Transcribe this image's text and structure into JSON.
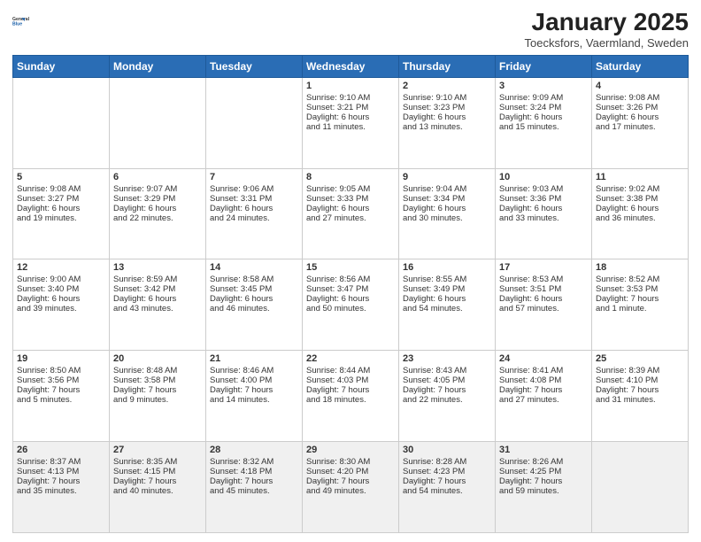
{
  "header": {
    "logo_line1": "General",
    "logo_line2": "Blue",
    "month_title": "January 2025",
    "location": "Toecksfors, Vaermland, Sweden"
  },
  "days_of_week": [
    "Sunday",
    "Monday",
    "Tuesday",
    "Wednesday",
    "Thursday",
    "Friday",
    "Saturday"
  ],
  "weeks": [
    [
      {
        "day": "",
        "info": ""
      },
      {
        "day": "",
        "info": ""
      },
      {
        "day": "",
        "info": ""
      },
      {
        "day": "1",
        "info": "Sunrise: 9:10 AM\nSunset: 3:21 PM\nDaylight: 6 hours\nand 11 minutes."
      },
      {
        "day": "2",
        "info": "Sunrise: 9:10 AM\nSunset: 3:23 PM\nDaylight: 6 hours\nand 13 minutes."
      },
      {
        "day": "3",
        "info": "Sunrise: 9:09 AM\nSunset: 3:24 PM\nDaylight: 6 hours\nand 15 minutes."
      },
      {
        "day": "4",
        "info": "Sunrise: 9:08 AM\nSunset: 3:26 PM\nDaylight: 6 hours\nand 17 minutes."
      }
    ],
    [
      {
        "day": "5",
        "info": "Sunrise: 9:08 AM\nSunset: 3:27 PM\nDaylight: 6 hours\nand 19 minutes."
      },
      {
        "day": "6",
        "info": "Sunrise: 9:07 AM\nSunset: 3:29 PM\nDaylight: 6 hours\nand 22 minutes."
      },
      {
        "day": "7",
        "info": "Sunrise: 9:06 AM\nSunset: 3:31 PM\nDaylight: 6 hours\nand 24 minutes."
      },
      {
        "day": "8",
        "info": "Sunrise: 9:05 AM\nSunset: 3:33 PM\nDaylight: 6 hours\nand 27 minutes."
      },
      {
        "day": "9",
        "info": "Sunrise: 9:04 AM\nSunset: 3:34 PM\nDaylight: 6 hours\nand 30 minutes."
      },
      {
        "day": "10",
        "info": "Sunrise: 9:03 AM\nSunset: 3:36 PM\nDaylight: 6 hours\nand 33 minutes."
      },
      {
        "day": "11",
        "info": "Sunrise: 9:02 AM\nSunset: 3:38 PM\nDaylight: 6 hours\nand 36 minutes."
      }
    ],
    [
      {
        "day": "12",
        "info": "Sunrise: 9:00 AM\nSunset: 3:40 PM\nDaylight: 6 hours\nand 39 minutes."
      },
      {
        "day": "13",
        "info": "Sunrise: 8:59 AM\nSunset: 3:42 PM\nDaylight: 6 hours\nand 43 minutes."
      },
      {
        "day": "14",
        "info": "Sunrise: 8:58 AM\nSunset: 3:45 PM\nDaylight: 6 hours\nand 46 minutes."
      },
      {
        "day": "15",
        "info": "Sunrise: 8:56 AM\nSunset: 3:47 PM\nDaylight: 6 hours\nand 50 minutes."
      },
      {
        "day": "16",
        "info": "Sunrise: 8:55 AM\nSunset: 3:49 PM\nDaylight: 6 hours\nand 54 minutes."
      },
      {
        "day": "17",
        "info": "Sunrise: 8:53 AM\nSunset: 3:51 PM\nDaylight: 6 hours\nand 57 minutes."
      },
      {
        "day": "18",
        "info": "Sunrise: 8:52 AM\nSunset: 3:53 PM\nDaylight: 7 hours\nand 1 minute."
      }
    ],
    [
      {
        "day": "19",
        "info": "Sunrise: 8:50 AM\nSunset: 3:56 PM\nDaylight: 7 hours\nand 5 minutes."
      },
      {
        "day": "20",
        "info": "Sunrise: 8:48 AM\nSunset: 3:58 PM\nDaylight: 7 hours\nand 9 minutes."
      },
      {
        "day": "21",
        "info": "Sunrise: 8:46 AM\nSunset: 4:00 PM\nDaylight: 7 hours\nand 14 minutes."
      },
      {
        "day": "22",
        "info": "Sunrise: 8:44 AM\nSunset: 4:03 PM\nDaylight: 7 hours\nand 18 minutes."
      },
      {
        "day": "23",
        "info": "Sunrise: 8:43 AM\nSunset: 4:05 PM\nDaylight: 7 hours\nand 22 minutes."
      },
      {
        "day": "24",
        "info": "Sunrise: 8:41 AM\nSunset: 4:08 PM\nDaylight: 7 hours\nand 27 minutes."
      },
      {
        "day": "25",
        "info": "Sunrise: 8:39 AM\nSunset: 4:10 PM\nDaylight: 7 hours\nand 31 minutes."
      }
    ],
    [
      {
        "day": "26",
        "info": "Sunrise: 8:37 AM\nSunset: 4:13 PM\nDaylight: 7 hours\nand 35 minutes."
      },
      {
        "day": "27",
        "info": "Sunrise: 8:35 AM\nSunset: 4:15 PM\nDaylight: 7 hours\nand 40 minutes."
      },
      {
        "day": "28",
        "info": "Sunrise: 8:32 AM\nSunset: 4:18 PM\nDaylight: 7 hours\nand 45 minutes."
      },
      {
        "day": "29",
        "info": "Sunrise: 8:30 AM\nSunset: 4:20 PM\nDaylight: 7 hours\nand 49 minutes."
      },
      {
        "day": "30",
        "info": "Sunrise: 8:28 AM\nSunset: 4:23 PM\nDaylight: 7 hours\nand 54 minutes."
      },
      {
        "day": "31",
        "info": "Sunrise: 8:26 AM\nSunset: 4:25 PM\nDaylight: 7 hours\nand 59 minutes."
      },
      {
        "day": "",
        "info": ""
      }
    ]
  ]
}
